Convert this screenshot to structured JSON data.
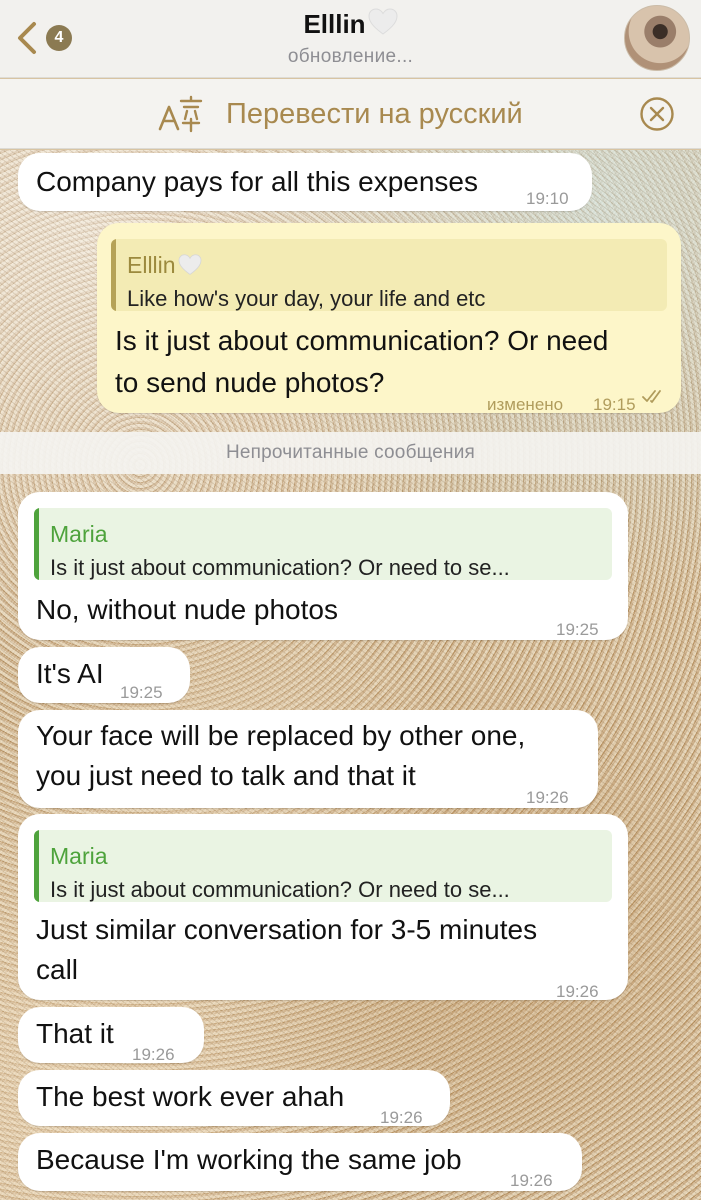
{
  "header": {
    "title": "Elllin",
    "title_suffix_icon": "white-heart-icon",
    "status": "обновление...",
    "back_badge": "4"
  },
  "translate_bar": {
    "label": "Перевести на русский"
  },
  "divider": {
    "unread_label": "Непрочитанные сообщения"
  },
  "messages": [
    {
      "direction": "incoming",
      "text": "Company pays for all this expenses",
      "time": "19:10"
    },
    {
      "direction": "outgoing",
      "reply_to": {
        "name": "Elllin",
        "text": "Like how's your day, your life and etc"
      },
      "lines": [
        "Is it just about communication? Or need",
        "to send nude photos?"
      ],
      "status_label": "изменено",
      "time": "19:15"
    },
    {
      "direction": "incoming",
      "reply_to": {
        "name": "Maria",
        "text": "Is it just about communication? Or need to se..."
      },
      "text": "No, without nude photos",
      "time": "19:25"
    },
    {
      "direction": "incoming",
      "text": "It's AI",
      "time": "19:25"
    },
    {
      "direction": "incoming",
      "lines": [
        "Your face will be replaced by other one,",
        "you just need to talk and that it"
      ],
      "time": "19:26"
    },
    {
      "direction": "incoming",
      "reply_to": {
        "name": "Maria",
        "text": "Is it just about communication? Or need to se..."
      },
      "lines": [
        "Just similar conversation for 3-5 minutes",
        "call"
      ],
      "time": "19:26"
    },
    {
      "direction": "incoming",
      "text": "That it",
      "time": "19:26"
    },
    {
      "direction": "incoming",
      "text": "The best work ever ahah",
      "time": "19:26"
    },
    {
      "direction": "incoming",
      "text": "Because I'm working the same job",
      "time": "19:26"
    }
  ],
  "colors": {
    "accent_gold": "#a8894f",
    "outgoing_bubble": "#fdf6c9",
    "incoming_bubble": "#ffffff",
    "reply_green": "#4ea33c"
  }
}
